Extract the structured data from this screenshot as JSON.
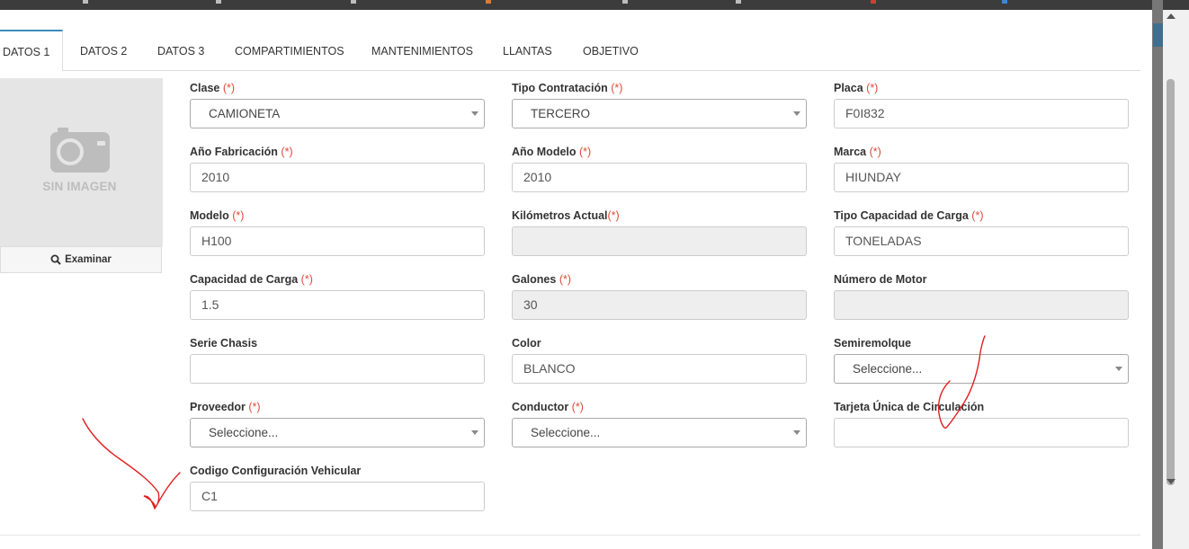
{
  "tabs": [
    "DATOS 1",
    "DATOS 2",
    "DATOS 3",
    "COMPARTIMIENTOS",
    "MANTENIMIENTOS",
    "LLANTAS",
    "OBJETIVO"
  ],
  "image_panel": {
    "placeholder_text": "SIN IMAGEN",
    "browse_button": "Examinar",
    "icon": "camera-icon"
  },
  "required_mark": "(*)",
  "fields": {
    "clase": {
      "label": "Clase",
      "value": "CAMIONETA"
    },
    "tipo_contratacion": {
      "label": "Tipo Contratación",
      "value": "TERCERO"
    },
    "placa": {
      "label": "Placa",
      "value": "F0I832"
    },
    "anio_fabricacion": {
      "label": "Año Fabricación",
      "value": "2010"
    },
    "anio_modelo": {
      "label": "Año Modelo",
      "value": "2010"
    },
    "marca": {
      "label": "Marca",
      "value": "HIUNDAY"
    },
    "modelo": {
      "label": "Modelo",
      "value": "H100"
    },
    "kilometros_actual": {
      "label": "Kilómetros Actual",
      "value": ""
    },
    "tipo_capacidad_carga": {
      "label": "Tipo Capacidad de Carga",
      "value": "TONELADAS"
    },
    "capacidad_carga": {
      "label": "Capacidad de Carga",
      "value": "1.5"
    },
    "galones": {
      "label": "Galones",
      "value": "30"
    },
    "numero_motor": {
      "label": "Número de Motor",
      "value": ""
    },
    "serie_chasis": {
      "label": "Serie Chasis",
      "value": ""
    },
    "color": {
      "label": "Color",
      "value": "BLANCO"
    },
    "semiremolque": {
      "label": "Semiremolque",
      "value": "Seleccione..."
    },
    "proveedor": {
      "label": "Proveedor",
      "value": "Seleccione..."
    },
    "conductor": {
      "label": "Conductor",
      "value": "Seleccione..."
    },
    "tarjeta_unica": {
      "label": "Tarjeta Única de Circulación",
      "value": ""
    },
    "codigo_config": {
      "label": "Codigo Configuración Vehicular",
      "value": "C1"
    }
  },
  "colors": {
    "accent": "#3c8dbc",
    "required": "#dd4b39",
    "annotation": "#e02020"
  }
}
